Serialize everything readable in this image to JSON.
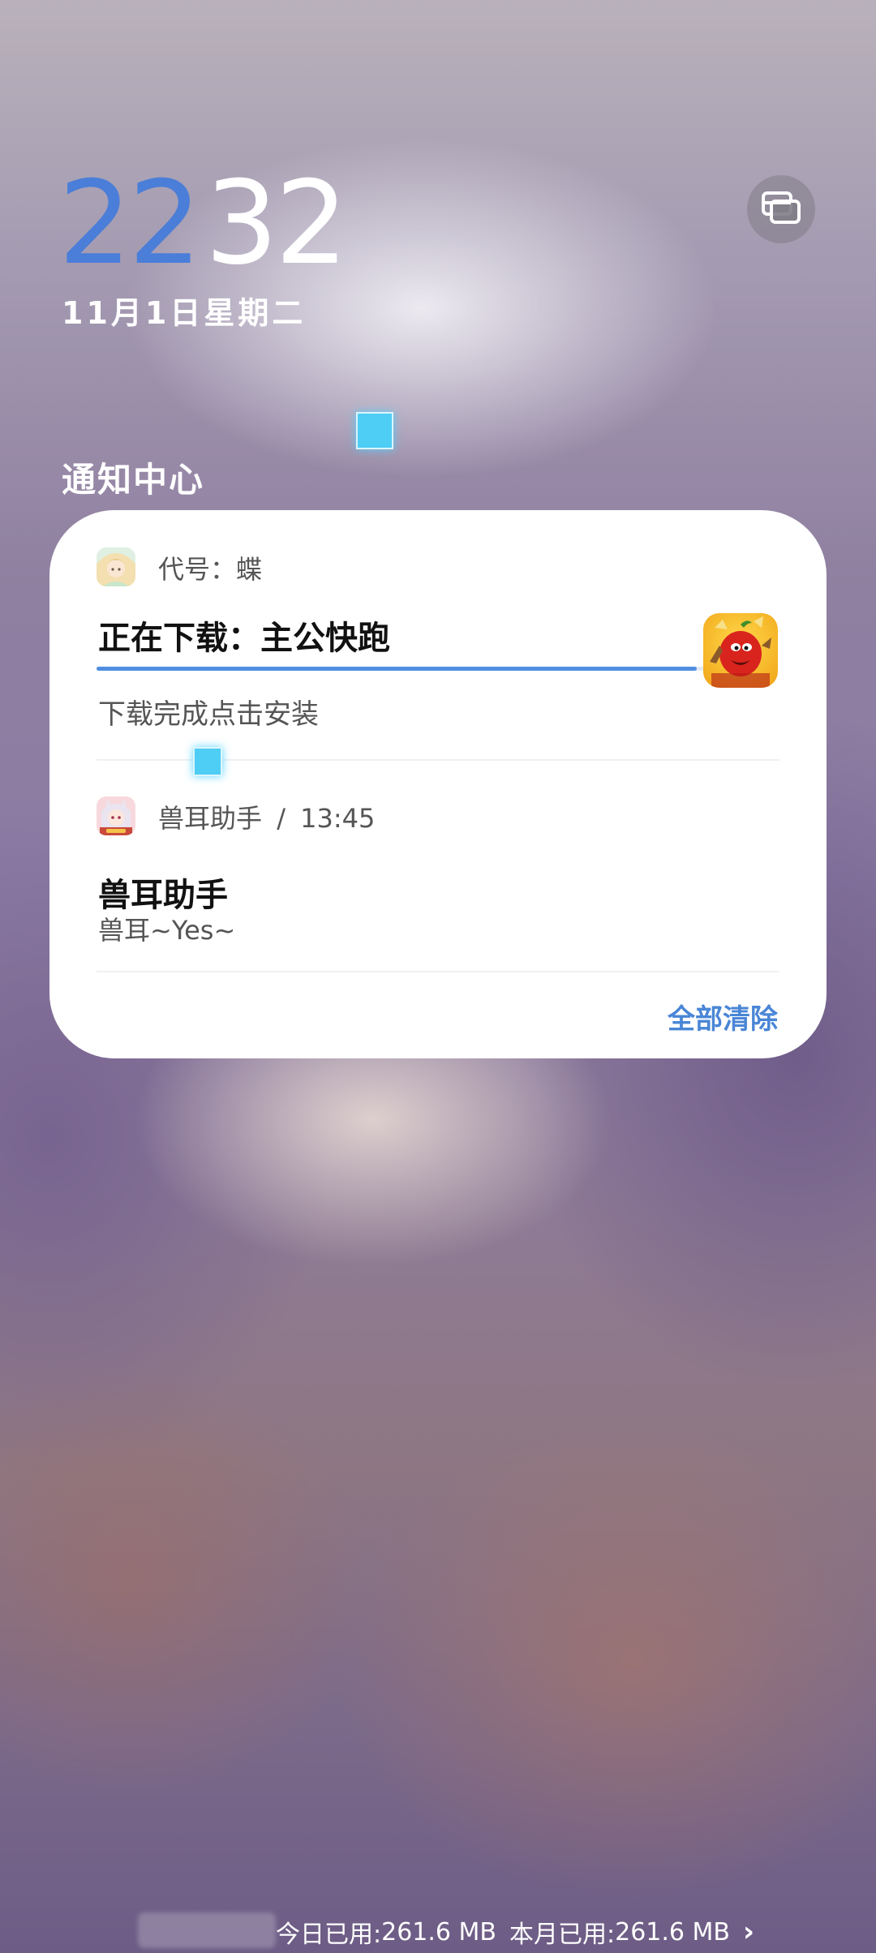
{
  "lockscreen": {
    "clock_hours": "22",
    "clock_minutes": "32",
    "date": "11月1日星期二",
    "top_right_icon": "layers-icon"
  },
  "notification_center": {
    "title": "通知中心",
    "clear_all_label": "全部清除",
    "notifications": [
      {
        "app_name": "代号：蝶",
        "title": "正在下载：主公快跑",
        "subtitle": "下载完成点击安装",
        "progress": 0.92,
        "progress_color": "#4f8ee0",
        "icon": "anime-girl-app-icon",
        "large_icon": "game-chili-character-icon"
      },
      {
        "app_name": "兽耳助手",
        "separator": "/",
        "time": "13:45",
        "title": "兽耳助手",
        "body": "兽耳~Yes~",
        "icon": "anime-catgirl-app-icon"
      }
    ]
  },
  "data_usage": {
    "today_label": "今日已用:",
    "today_value": "261.6 MB",
    "month_label": "本月已用:",
    "month_value": "261.6 MB"
  },
  "colors": {
    "clock_hours": "#4a7ed8",
    "accent": "#4a86d6"
  }
}
